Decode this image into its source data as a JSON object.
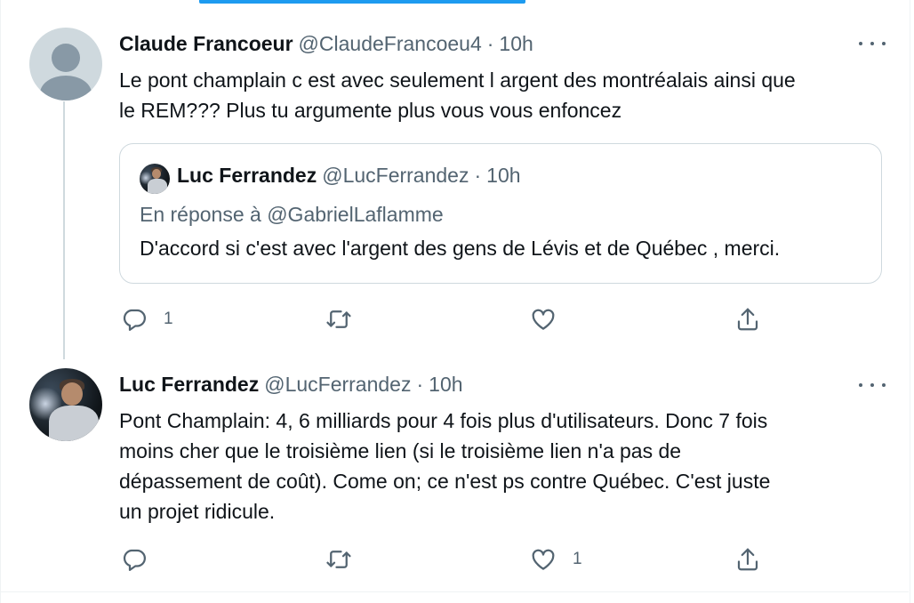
{
  "tweets": [
    {
      "name": "Claude Francoeur",
      "handle": "@ClaudeFrancoeu4",
      "separator": "·",
      "time": "10h",
      "text": [
        "Le pont champlain c est avec seulement l argent des montréalais ainsi que",
        "le REM??? Plus tu argumente plus vous vous enfoncez"
      ],
      "quote": {
        "name": "Luc Ferrandez",
        "handle": "@LucFerrandez",
        "separator": "·",
        "time": "10h",
        "reply_to": "En réponse à @GabrielLaflamme",
        "text": "D'accord si c'est avec l'argent des gens de Lévis et de Québec , merci."
      },
      "actions": {
        "reply_count": "1",
        "retweet_count": "",
        "like_count": ""
      }
    },
    {
      "name": "Luc Ferrandez",
      "handle": "@LucFerrandez",
      "separator": "·",
      "time": "10h",
      "text": [
        "Pont Champlain: 4, 6 milliards pour 4 fois plus d'utilisateurs. Donc 7 fois",
        "moins cher que le troisième lien (si le troisième lien n'a pas de",
        "dépassement de coût). Come on; ce n'est ps contre Québec. C'est juste",
        "un projet ridicule."
      ],
      "actions": {
        "reply_count": "",
        "retweet_count": "",
        "like_count": "1"
      }
    }
  ],
  "icons": [
    "reply-icon",
    "retweet-icon",
    "like-icon",
    "share-icon",
    "more-icon"
  ],
  "colors": {
    "accent": "#1d9bf0",
    "secondary_text": "#536471",
    "border": "#cfd9de"
  }
}
